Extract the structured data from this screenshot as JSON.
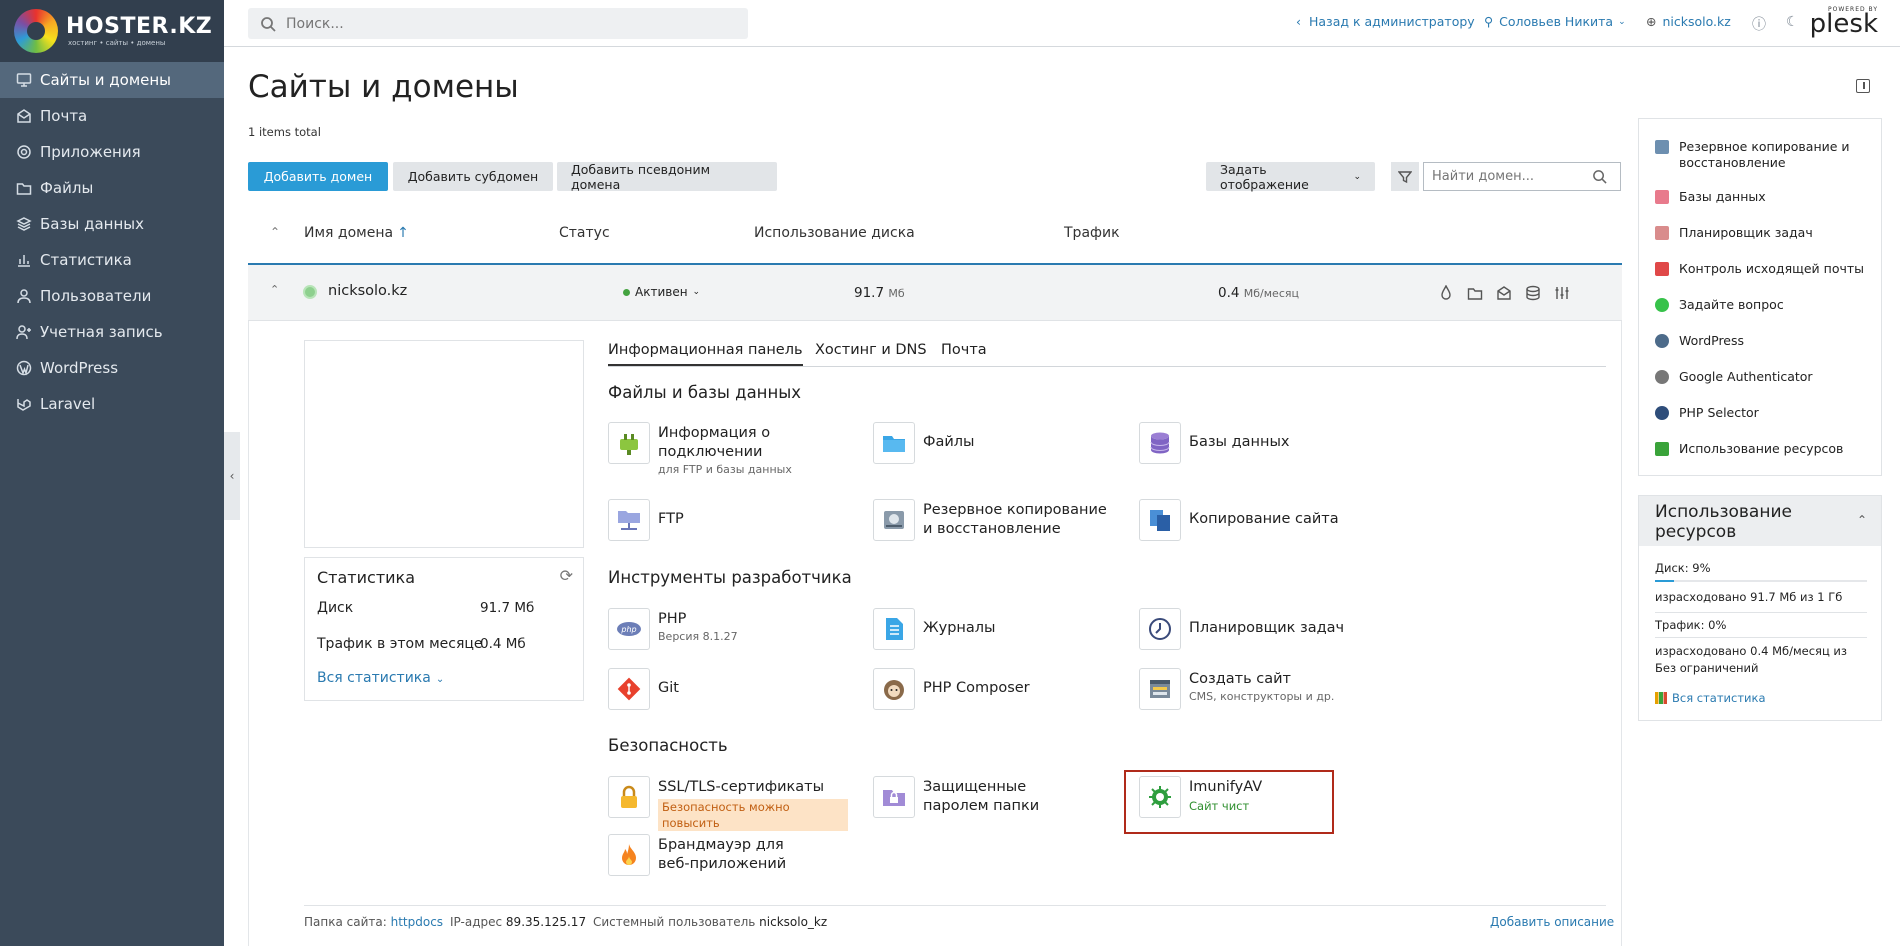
{
  "brand": {
    "name": "HOSTER.KZ",
    "tagline": "хостинг • сайты • домены"
  },
  "nav": [
    {
      "label": "Сайты и домены",
      "icon": "monitor-icon",
      "active": true
    },
    {
      "label": "Почта",
      "icon": "mail-icon"
    },
    {
      "label": "Приложения",
      "icon": "gear-icon"
    },
    {
      "label": "Файлы",
      "icon": "folder-icon"
    },
    {
      "label": "Базы данных",
      "icon": "layers-icon"
    },
    {
      "label": "Статистика",
      "icon": "chart-icon"
    },
    {
      "label": "Пользователи",
      "icon": "user-icon"
    },
    {
      "label": "Учетная запись",
      "icon": "account-icon"
    },
    {
      "label": "WordPress",
      "icon": "wordpress-icon"
    },
    {
      "label": "Laravel",
      "icon": "laravel-icon"
    }
  ],
  "topbar": {
    "search_placeholder": "Поиск...",
    "back": "Назад к администратору",
    "user": "Соловьев Никита",
    "domain": "nicksolo.kz",
    "plesk_powered": "POWERED BY",
    "plesk_name": "plesk"
  },
  "page": {
    "title": "Сайты и домены",
    "items_total": "1 items total"
  },
  "buttons": {
    "add_domain": "Добавить домен",
    "add_subdomain": "Добавить субдомен",
    "add_alias": "Добавить псевдоним домена",
    "view": "Задать отображение",
    "domain_search_placeholder": "Найти домен..."
  },
  "table": {
    "headers": {
      "name": "Имя домена",
      "status": "Статус",
      "disk": "Использование диска",
      "traffic": "Трафик"
    }
  },
  "row": {
    "domain": "nicksolo.kz",
    "status": "Активен",
    "disk": "91.7",
    "disk_unit": "Мб",
    "traffic": "0.4",
    "traffic_unit": "Мб/месяц"
  },
  "stats": {
    "title": "Статистика",
    "disk_label": "Диск",
    "disk_value": "91.7 Мб",
    "traffic_label": "Трафик в этом месяце",
    "traffic_value": "0.4 Мб",
    "all_link": "Вся статистика"
  },
  "tabs": [
    "Информационная панель",
    "Хостинг и DNS",
    "Почта"
  ],
  "sections": {
    "files": "Файлы и базы данных",
    "dev": "Инструменты разработчика",
    "security": "Безопасность"
  },
  "tools": {
    "conn": {
      "label": "Информация о подключении",
      "sub": "для FTP и базы данных"
    },
    "files": {
      "label": "Файлы"
    },
    "db": {
      "label": "Базы данных"
    },
    "ftp": {
      "label": "FTP"
    },
    "backup": {
      "label": "Резервное копирование и восстановление"
    },
    "copy": {
      "label": "Копирование сайта"
    },
    "php": {
      "label": "PHP",
      "sub": "Версия 8.1.27"
    },
    "logs": {
      "label": "Журналы"
    },
    "sched": {
      "label": "Планировщик задач"
    },
    "git": {
      "label": "Git"
    },
    "composer": {
      "label": "PHP Composer"
    },
    "create": {
      "label": "Создать сайт",
      "sub": "CMS, конструкторы и др."
    },
    "ssl": {
      "label": "SSL/TLS-сертификаты",
      "sub": "Безопасность можно повысить"
    },
    "protected": {
      "label": "Защищенные паролем папки"
    },
    "imunify": {
      "label": "ImunifyAV",
      "sub": "Сайт чист"
    },
    "waf": {
      "label": "Брандмауэр для веб-приложений"
    }
  },
  "footer": {
    "folder_label": "Папка сайта:",
    "folder": "httpdocs",
    "ip_label": "IP-адрес",
    "ip": "89.35.125.17",
    "user_label": "Системный пользователь",
    "user": "nicksolo_kz",
    "add_desc": "Добавить описание"
  },
  "right_links": [
    {
      "label": "Резервное копирование и восстановление",
      "color": "#6d8fb0"
    },
    {
      "label": "Базы данных",
      "color": "#e87a8c"
    },
    {
      "label": "Планировщик задач",
      "color": "#d98c8c"
    },
    {
      "label": "Контроль исходящей почты",
      "color": "#e04848"
    },
    {
      "label": "Задайте вопрос",
      "color": "#37c24a"
    },
    {
      "label": "WordPress",
      "color": "#4d6b8a"
    },
    {
      "label": "Google Authenticator",
      "color": "#777777"
    },
    {
      "label": "PHP Selector",
      "color": "#2e4d7a"
    },
    {
      "label": "Использование ресурсов",
      "color": "#3aa33a"
    }
  ],
  "resources": {
    "title": "Использование ресурсов",
    "disk_label": "Диск: 9%",
    "disk_percent": 9,
    "disk_used": "израсходовано 91.7 Мб из 1 Гб",
    "traffic_label": "Трафик: 0%",
    "traffic_percent": 0,
    "traffic_used": "израсходовано 0.4 Мб/месяц из Без ограничений",
    "all_link": "Вся статистика"
  }
}
